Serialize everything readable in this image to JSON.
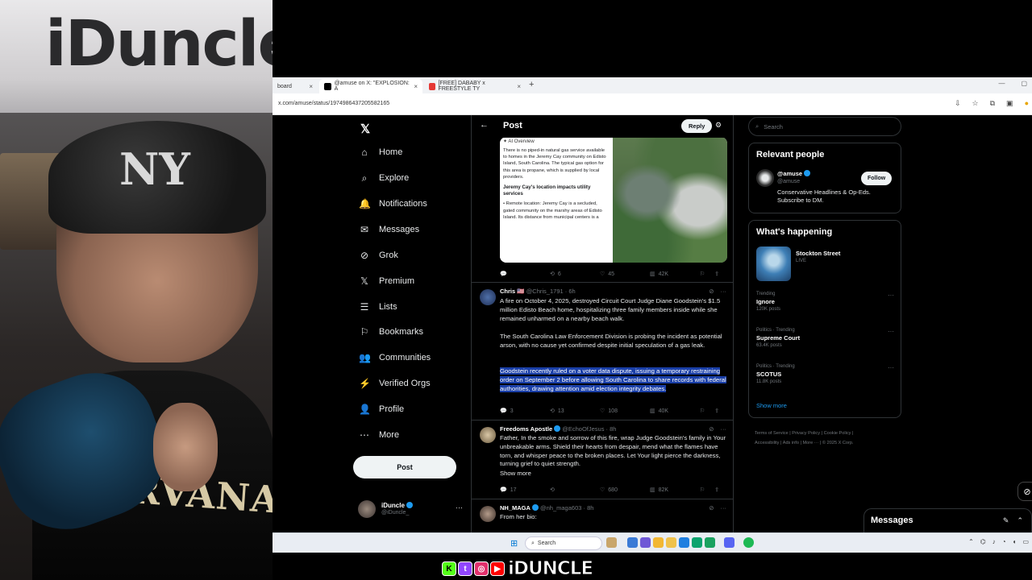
{
  "webcam": {
    "sign_text": "iDuncle",
    "cap_logo": "NY",
    "shirt_text": "NIRVANA"
  },
  "browser": {
    "tabs": [
      {
        "label": "board",
        "close": "×"
      },
      {
        "label": "@amuse on X: \"EXPLOSION: A",
        "close": "×"
      },
      {
        "label": "[FREE] DABABY x FREESTYLE TY",
        "close": "×"
      }
    ],
    "new_tab": "+",
    "url": "x.com/amuse/status/1974986437205582165"
  },
  "x": {
    "logo": "𝕏",
    "nav": [
      {
        "icon": "⌂",
        "label": "Home"
      },
      {
        "icon": "⌕",
        "label": "Explore"
      },
      {
        "icon": "🔔",
        "label": "Notifications"
      },
      {
        "icon": "✉",
        "label": "Messages"
      },
      {
        "icon": "⊘",
        "label": "Grok"
      },
      {
        "icon": "𝕏",
        "label": "Premium"
      },
      {
        "icon": "☰",
        "label": "Lists"
      },
      {
        "icon": "⚐",
        "label": "Bookmarks"
      },
      {
        "icon": "👥",
        "label": "Communities"
      },
      {
        "icon": "⚡",
        "label": "Verified Orgs"
      },
      {
        "icon": "👤",
        "label": "Profile"
      },
      {
        "icon": "⋯",
        "label": "More"
      }
    ],
    "post_button": "Post",
    "account": {
      "name": "iDuncle",
      "handle": "@iDuncle_",
      "more": "···"
    },
    "header": {
      "back": "←",
      "title": "Post",
      "reply": "Reply",
      "filter": "⚙"
    },
    "ai_overview": {
      "header": "✦ AI Overview",
      "p1": "There is no piped-in natural gas service available to homes in the Jeremy Cay community on Edisto Island, South Carolina. The typical gas option for this area is propane, which is supplied by local providers.",
      "h2": "Jeremy Cay's location impacts utility services",
      "p2": "• Remote location: Jeremy Cay is a secluded, gated community on the marshy areas of Edisto Island. Its distance from municipal centers is a"
    },
    "first_actions": {
      "replies": "",
      "reposts": "6",
      "likes": "45",
      "views": "42K"
    },
    "tweets": [
      {
        "name": "Chris 🇺🇸",
        "handle": "@Chris_1791 · 6h",
        "p1": "A fire on October 4, 2025, destroyed Circuit Court Judge Diane Goodstein's $1.5 million Edisto Beach home, hospitalizing three family members inside while she remained unharmed on a nearby beach walk.",
        "p2": "The South Carolina Law Enforcement Division is probing the incident as potential arson, with no cause yet confirmed despite initial speculation of a gas leak.",
        "p3": "Goodstein recently ruled on a voter data dispute, issuing a temporary restraining order on September 2 before allowing South Carolina to share records with federal authorities, drawing attention amid election integrity debates.",
        "replies": "3",
        "reposts": "13",
        "likes": "108",
        "views": "40K"
      },
      {
        "name": "Freedoms Apostle",
        "handle": "@EchoOfJesus · 8h",
        "p1": "Father, In the smoke and sorrow of this fire, wrap Judge Goodstein's family in Your unbreakable arms. Shield their hearts from despair, mend what the flames have torn, and whisper peace to the broken places. Let Your light pierce the darkness, turning grief to quiet strength.",
        "show_more": "Show more",
        "replies": "17",
        "reposts": "",
        "likes": "680",
        "views": "82K"
      },
      {
        "name": "NH_MAGA",
        "handle": "@nh_maga603 · 8h",
        "p1": "From her bio:"
      }
    ],
    "search_placeholder": "Search",
    "relevant": {
      "title": "Relevant people",
      "name": "@amuse",
      "handle": "@amuse",
      "follow": "Follow",
      "bio": "Conservative Headlines & Op-Eds. Subscribe to DM."
    },
    "happening": {
      "title": "What's happening",
      "live_title": "Stockton Street",
      "live": "LIVE",
      "trends": [
        {
          "context": "Trending",
          "name": "Ignore",
          "posts": "120K posts"
        },
        {
          "context": "Politics · Trending",
          "name": "Supreme Court",
          "posts": "63.4K posts"
        },
        {
          "context": "Politics · Trending",
          "name": "SCOTUS",
          "posts": "11.8K posts"
        }
      ],
      "show_more": "Show more"
    },
    "footer": {
      "line1": "Terms of Service  |  Privacy Policy  |  Cookie Policy  |",
      "line2": "Accessibility  |  Ads info  |  More ···  |  © 2025 X Corp."
    },
    "messages_dock": "Messages"
  },
  "taskbar": {
    "search": "Search"
  },
  "overlay": {
    "handle": "iDUNCLE"
  },
  "colors": {
    "accent": "#1d9bf0",
    "highlight": "#1a3fa8",
    "background": "#000000"
  }
}
